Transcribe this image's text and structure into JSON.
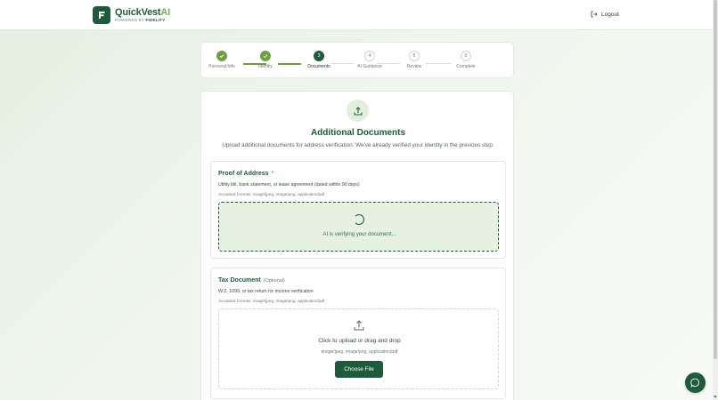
{
  "header": {
    "brand_main": "QuickVest",
    "brand_ai": "AI",
    "powered_by": "POWERED BY",
    "powered_brand": "FIDELITY",
    "logout_label": "Logout"
  },
  "stepper": {
    "steps": [
      {
        "number": "1",
        "label": "Personal Info",
        "state": "done"
      },
      {
        "number": "2",
        "label": "Identity",
        "state": "done"
      },
      {
        "number": "3",
        "label": "Documents",
        "state": "active"
      },
      {
        "number": "4",
        "label": "AI Guidance",
        "state": "pending"
      },
      {
        "number": "5",
        "label": "Review",
        "state": "pending"
      },
      {
        "number": "6",
        "label": "Complete",
        "state": "pending"
      }
    ]
  },
  "main": {
    "title": "Additional Documents",
    "subtitle": "Upload additional documents for address verification. We've already verified your identity in the previous step."
  },
  "proof_of_address": {
    "title": "Proof of Address",
    "required_mark": "*",
    "description": "Utility bill, bank statement, or lease agreement (dated within 90 days)",
    "formats": "Accepted formats: image/jpeg, image/png, application/pdf",
    "status_text": "AI is verifying your document..."
  },
  "tax_document": {
    "title": "Tax Document",
    "optional_label": "(Optional)",
    "description": "W-2, 1099, or tax return for income verification",
    "formats": "Accepted formats: image/jpeg, image/png, application/pdf",
    "dropzone_text": "Click to upload or drag and drop",
    "dropzone_formats": "image/jpeg, image/png, application/pdf",
    "button_label": "Choose File"
  },
  "colors": {
    "brand": "#1e5b3b",
    "accent": "#6ea13e",
    "required": "#d23c3c"
  },
  "icons": {
    "logo": "letter-f-logo",
    "logout": "logout-icon",
    "upload": "upload-icon",
    "chat": "chat-icon",
    "check": "check-icon"
  }
}
